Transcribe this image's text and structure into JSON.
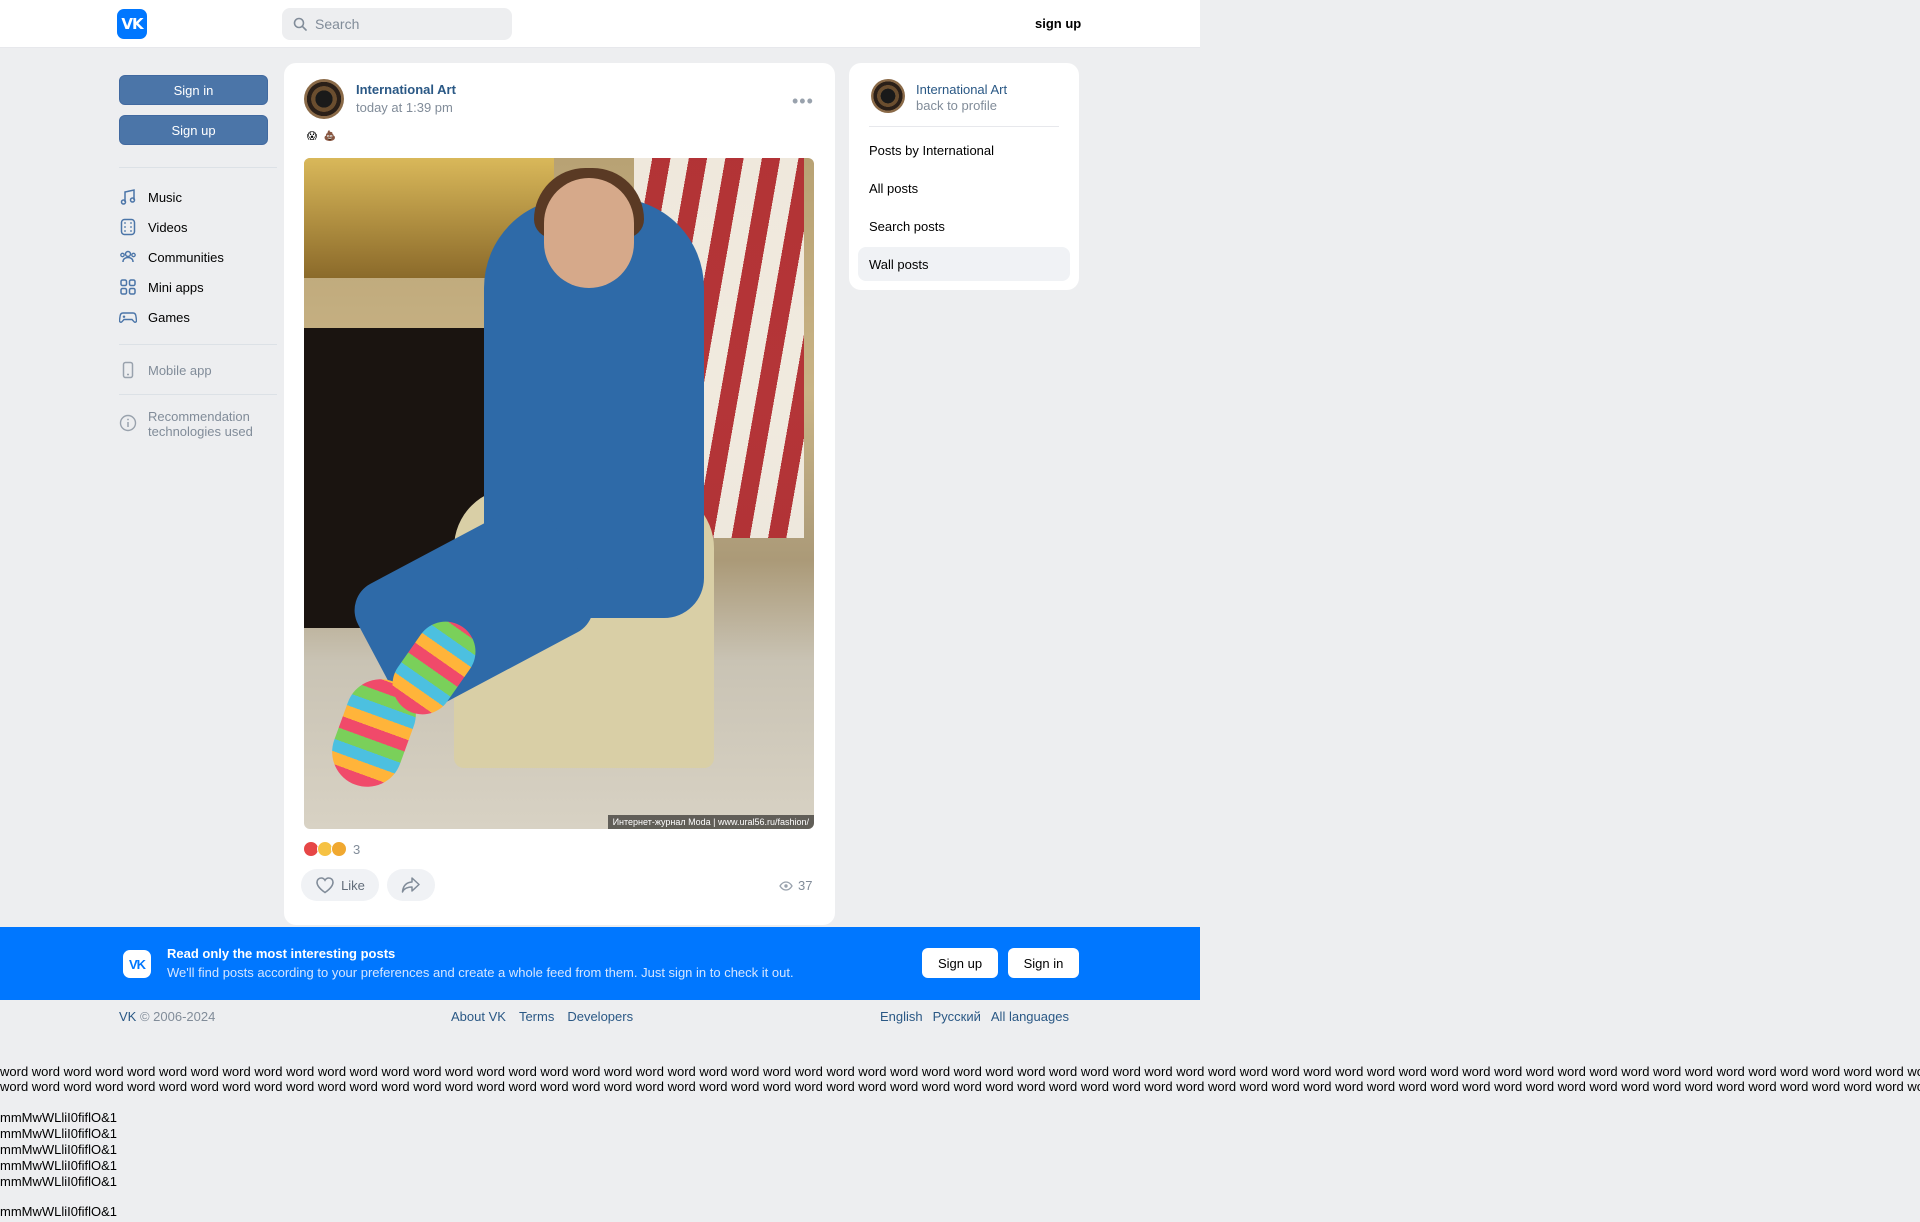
{
  "header": {
    "logo_text": "VK",
    "search_placeholder": "Search",
    "signup": "sign up"
  },
  "left_nav": {
    "sign_in": "Sign in",
    "sign_up": "Sign up",
    "items": [
      {
        "label": "Music",
        "icon": "music-icon"
      },
      {
        "label": "Videos",
        "icon": "video-icon"
      },
      {
        "label": "Communities",
        "icon": "communities-icon"
      },
      {
        "label": "Mini apps",
        "icon": "mini-apps-icon"
      },
      {
        "label": "Games",
        "icon": "gamepad-icon"
      }
    ],
    "mobile_app": "Mobile app",
    "recommendation_1": "Recommendation",
    "recommendation_2": "technologies used"
  },
  "post": {
    "author": "International Art",
    "time": "today at 1:39 pm",
    "emojis": [
      "😱",
      "💩"
    ],
    "photo_caption": "Интернет-журнал Moda | www.ural56.ru/fashion/",
    "reactions_count": "3",
    "like_label": "Like",
    "views": "37"
  },
  "right_panel": {
    "name": "International Art",
    "back": "back to profile",
    "items": [
      "Posts by International",
      "All posts",
      "Search posts",
      "Wall posts"
    ],
    "active_item": "Wall posts"
  },
  "banner": {
    "title": "Read only the most interesting posts",
    "subtitle": "We'll find posts according to your preferences and create a whole feed from them. Just sign in to check it out.",
    "signup": "Sign up",
    "signin": "Sign in"
  },
  "footer": {
    "copyright_brand": "VK",
    "copyright": "© 2006-2024",
    "links": [
      "About VK",
      "Terms",
      "Developers"
    ],
    "languages": [
      "English",
      "Русский",
      "All languages"
    ]
  },
  "test_text": {
    "word_line": "word word word word word word word word word word word word word word word word word word word word word word word word word word word word word word word word word word word word word word word word word word word word word word word word word word word word word word word word word word word word word word word word word word word word word word word word wor",
    "glyph_line": "mmMwWLliI0fiflO&1"
  },
  "colors": {
    "accent": "#0077ff",
    "link": "#2a5885",
    "button": "#4b75a8",
    "background": "#edeef0"
  }
}
